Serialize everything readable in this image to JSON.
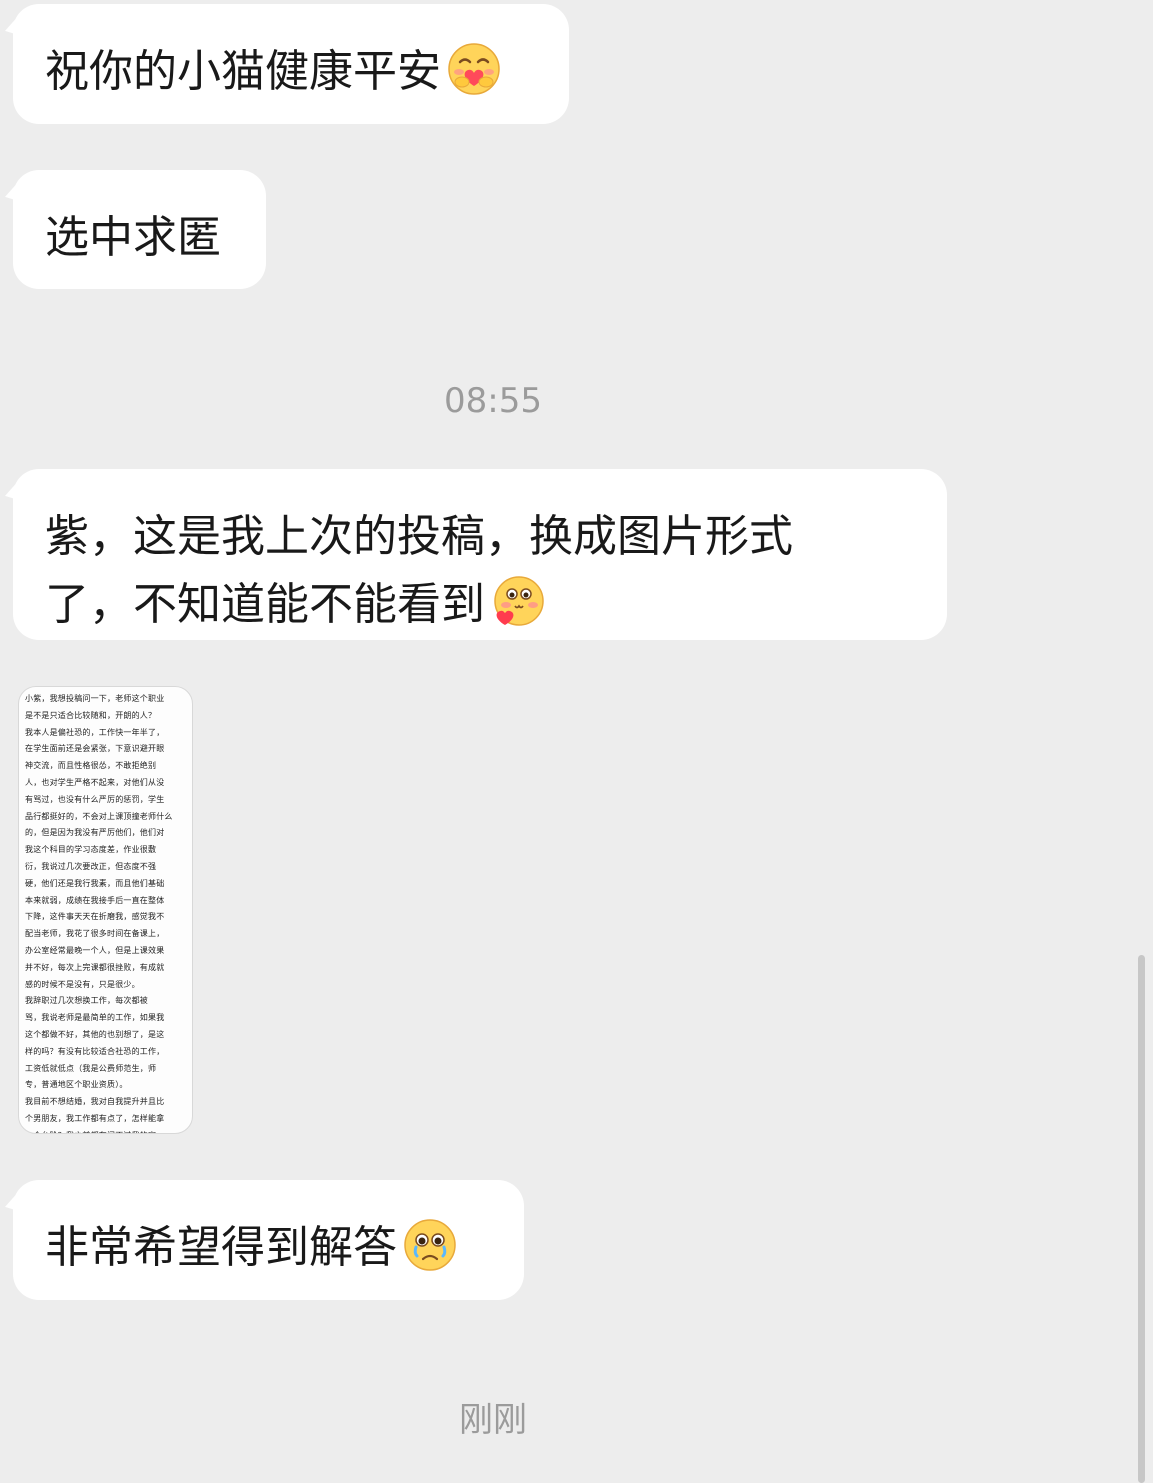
{
  "messages": [
    {
      "text": "祝你的小猫健康平安",
      "emoji": "hugging-face-icon"
    },
    {
      "text": "选中求匿"
    },
    {
      "line1": "紫，这是我上次的投稿，换成图片形式",
      "line2": "了，不知道能不能看到",
      "emoji": "shy-heart-face-icon"
    },
    {
      "text": "非常希望得到解答",
      "emoji": "pleading-face-icon"
    }
  ],
  "timestamps": {
    "first": "08:55",
    "second": "刚刚"
  },
  "image_message": {
    "lines": [
      "小紫，我想投稿问一下，老师这个职业",
      "是不是只适合比较随和，开朗的人？",
      "我本人是偏社恐的，工作快一年半了，",
      "在学生面前还是会紧张，下意识避开眼",
      "神交流，而且性格很怂，不敢拒绝别",
      "人，也对学生严格不起来，对他们从没",
      "有骂过，也没有什么严厉的惩罚，学生",
      "品行都挺好的，不会对上课顶撞老师什么",
      "的，但是因为我没有严厉他们，他们对",
      "我这个科目的学习态度差，作业很敷",
      "衍，我说过几次要改正，但态度不强",
      "硬，他们还是我行我素，而且他们基础",
      "本来就弱，成绩在我接手后一直在整体",
      "下降，这件事天天在折磨我，感觉我不",
      "配当老师，我花了很多时间在备课上，",
      "办公室经常最晚一个人，但是上课效果",
      "并不好，每次上完课都很挫败，有成就",
      "感的时候不是没有，只是很少。",
      "我辞职过几次想换工作，每次都被",
      "骂，我说老师是最简单的工作，如果我",
      "这个都做不好，其他的也别想了，是这",
      "样的吗？有没有比较适合社恐的工作，",
      "工资低就低点（我是公费师范生，师",
      "专，普通地区个职业资质）。",
      "我目前不想结婚，我对自我提升并且比",
      "个男朋友，我工作都有点了，怎样能拿",
      "一个台阶？我之前都有问不过我的家"
    ]
  },
  "colors": {
    "background": "#ededed",
    "bubble": "#ffffff",
    "text": "#191919",
    "timestamp": "#9b9b9b"
  }
}
